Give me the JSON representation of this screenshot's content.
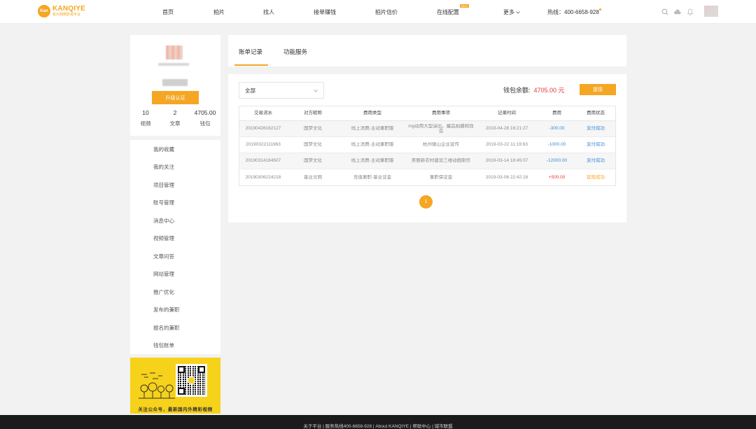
{
  "logo": {
    "badge": "Kan",
    "main": "KANQIYE",
    "sub": "看片网络影视平台"
  },
  "nav": {
    "items": [
      "首页",
      "拍片",
      "找人",
      "接单赚钱",
      "拍片估价",
      "在线配置",
      "更多"
    ],
    "new_badge": "NEW",
    "hotline": "热线：400-6658-928"
  },
  "profile": {
    "button": "升级认证",
    "stats": [
      {
        "num": "10",
        "label": "视频"
      },
      {
        "num": "2",
        "label": "文章"
      },
      {
        "num": "4705.00",
        "label": "钱包"
      }
    ]
  },
  "sidebar": {
    "items": [
      "我的收藏",
      "我的关注",
      "项目管理",
      "账号管理",
      "消息中心",
      "视频管理",
      "文章问答",
      "网站管理",
      "推广优化",
      "发布的兼职",
      "报名的兼职",
      "钱包账单"
    ]
  },
  "promo": {
    "caption": "关注公众号，最新国内外精彩视频"
  },
  "tabs": [
    "账单记录",
    "功能服务"
  ],
  "filter": {
    "value": "全部"
  },
  "wallet": {
    "label": "钱包余额:",
    "amount": "4705.00 元",
    "withdraw": "提现"
  },
  "table": {
    "headers": [
      "交易流水",
      "对方昵称",
      "费用类型",
      "费用事项",
      "记录时间",
      "费用",
      "费用状态"
    ],
    "rows": [
      {
        "serial": "20190428162127",
        "name": "国梦文化",
        "type": "线上消费-主动兼职服",
        "item": "mg动用大型演出，藏品拍摄和改造",
        "time": "2019-04-28 16:21:27",
        "amount": "-300.00",
        "status": "支付成功"
      },
      {
        "serial": "20190322111963",
        "name": "国梦文化",
        "type": "线上消费-主动兼职服",
        "item": "杭州微山企业宣传",
        "time": "2019-03-22 11:19:63",
        "amount": "-1000.00",
        "status": "支付成功"
      },
      {
        "serial": "20190314184507",
        "name": "国梦文化",
        "type": "线上消费-主动兼职服",
        "item": "美丽新农村建设三维动画制作",
        "time": "2019-03-14 18:45:07",
        "amount": "-12000.00",
        "status": "支付成功"
      },
      {
        "serial": "20190306224218",
        "name": "基业文网",
        "type": "充值兼职-基业证金",
        "item": "兼职保证金",
        "time": "2019-03-06 22:42:18",
        "amount": "+500.00",
        "status": "提现成功"
      }
    ]
  },
  "pager": {
    "current": "1"
  },
  "footer": {
    "text": "关于平台 | 服务热线400-6658-928 | About KANQIYE | 帮助中心 | 城市联盟"
  },
  "colors": {
    "accent": "#f5a623",
    "negative": "#3b8bd6",
    "positive": "#e4393c"
  }
}
